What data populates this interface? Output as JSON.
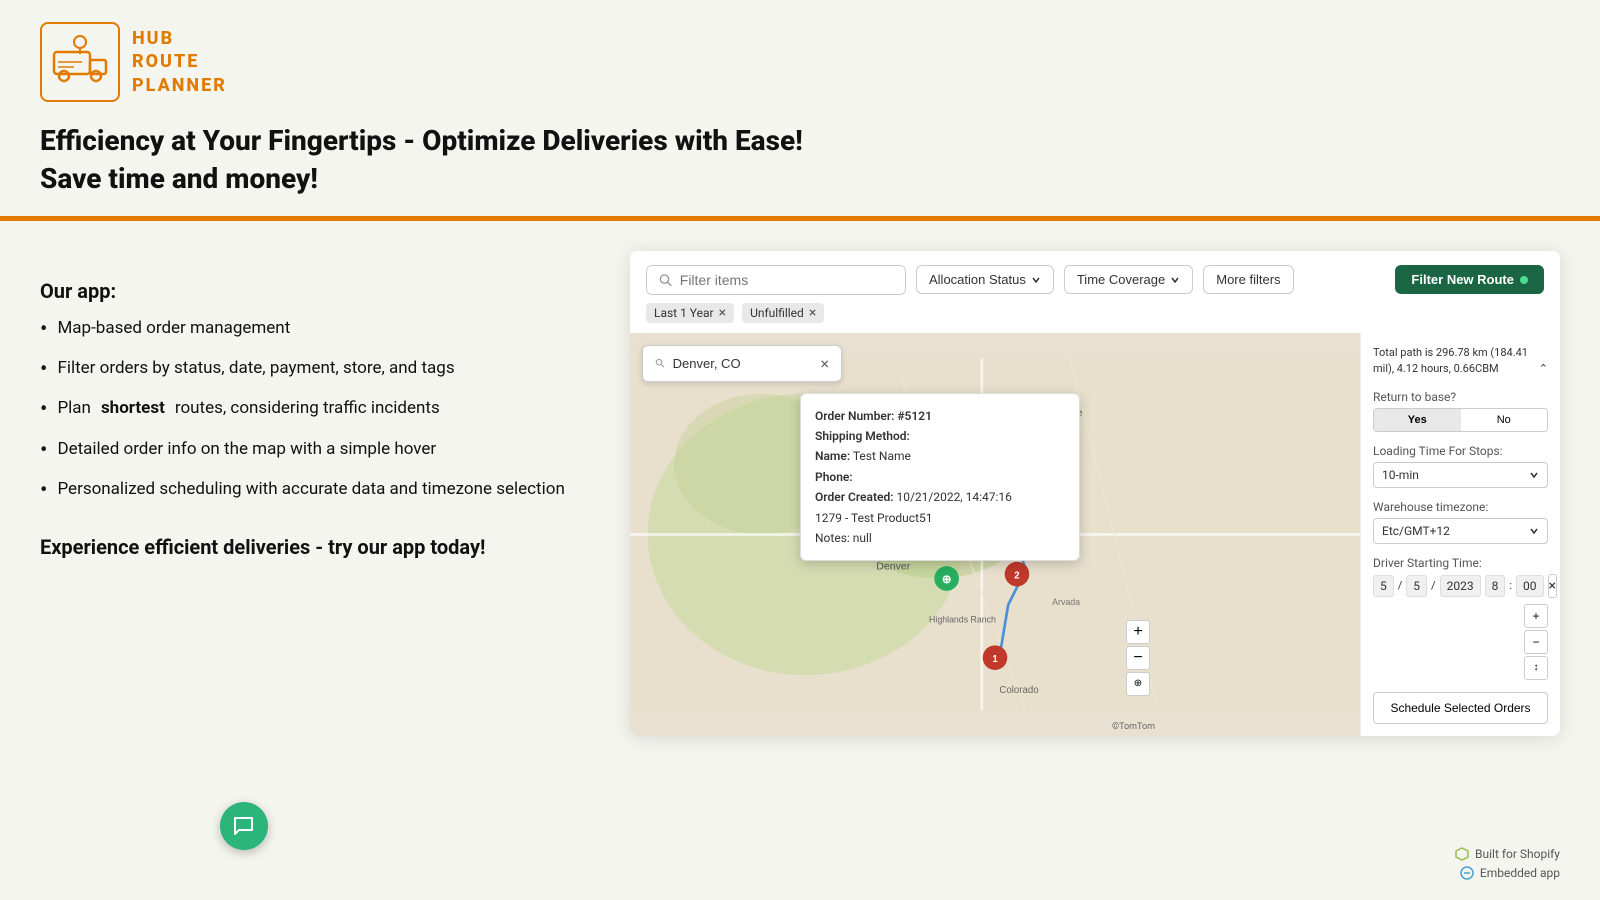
{
  "logo": {
    "line1": "HUB",
    "line2": "ROUTE",
    "line3": "PLANNER"
  },
  "headline": {
    "line1": "Efficiency at Your Fingertips - Optimize Deliveries with Ease!",
    "line2": "Save time and money!"
  },
  "our_app_label": "Our app:",
  "features": [
    "Map-based order management",
    "Filter orders by status, date, payment, store, and tags",
    "Plan shortest routes, considering traffic incidents",
    "Detailed order info on the map with a simple hover",
    "Personalized scheduling with accurate data and timezone selection"
  ],
  "feature_bold_word": "shortest",
  "cta": "Experience efficient deliveries - try our app today!",
  "toolbar": {
    "search_placeholder": "Filter items",
    "allocation_status_label": "Allocation Status",
    "time_coverage_label": "Time Coverage",
    "more_filters_label": "More filters",
    "filter_new_route_label": "Filter New Route"
  },
  "tags": [
    {
      "label": "Last 1 Year",
      "removable": true
    },
    {
      "label": "Unfulfilled",
      "removable": true
    }
  ],
  "map": {
    "search_value": "Denver, CO",
    "popup": {
      "order_number": "Order Number: #5121",
      "shipping_method": "Shipping Method:",
      "name_label": "Name:",
      "name_value": "Test Name",
      "phone_label": "Phone:",
      "order_created_label": "Order Created:",
      "order_created_value": "10/21/2022, 14:47:16",
      "product": "1279 - Test Product51",
      "notes": "Notes: null"
    }
  },
  "sidebar": {
    "path_info": "Total path is 296.78 km (184.41 mil), 4.12 hours, 0.66CBM",
    "return_to_base_label": "Return to base?",
    "yes_label": "Yes",
    "no_label": "No",
    "loading_time_label": "Loading Time For Stops:",
    "loading_time_value": "10-min",
    "warehouse_tz_label": "Warehouse timezone:",
    "warehouse_tz_value": "Etc/GMT+12",
    "driver_start_label": "Driver Starting Time:",
    "date_month": "5",
    "date_day": "5",
    "date_year": "2023",
    "time_hour": "8",
    "time_min": "00",
    "schedule_btn_label": "Schedule Selected Orders"
  },
  "badges": [
    {
      "icon": "shopify-icon",
      "label": "Built for Shopify"
    },
    {
      "icon": "embedded-icon",
      "label": "Embedded app"
    }
  ],
  "tomtom_credit": "©TomTom"
}
